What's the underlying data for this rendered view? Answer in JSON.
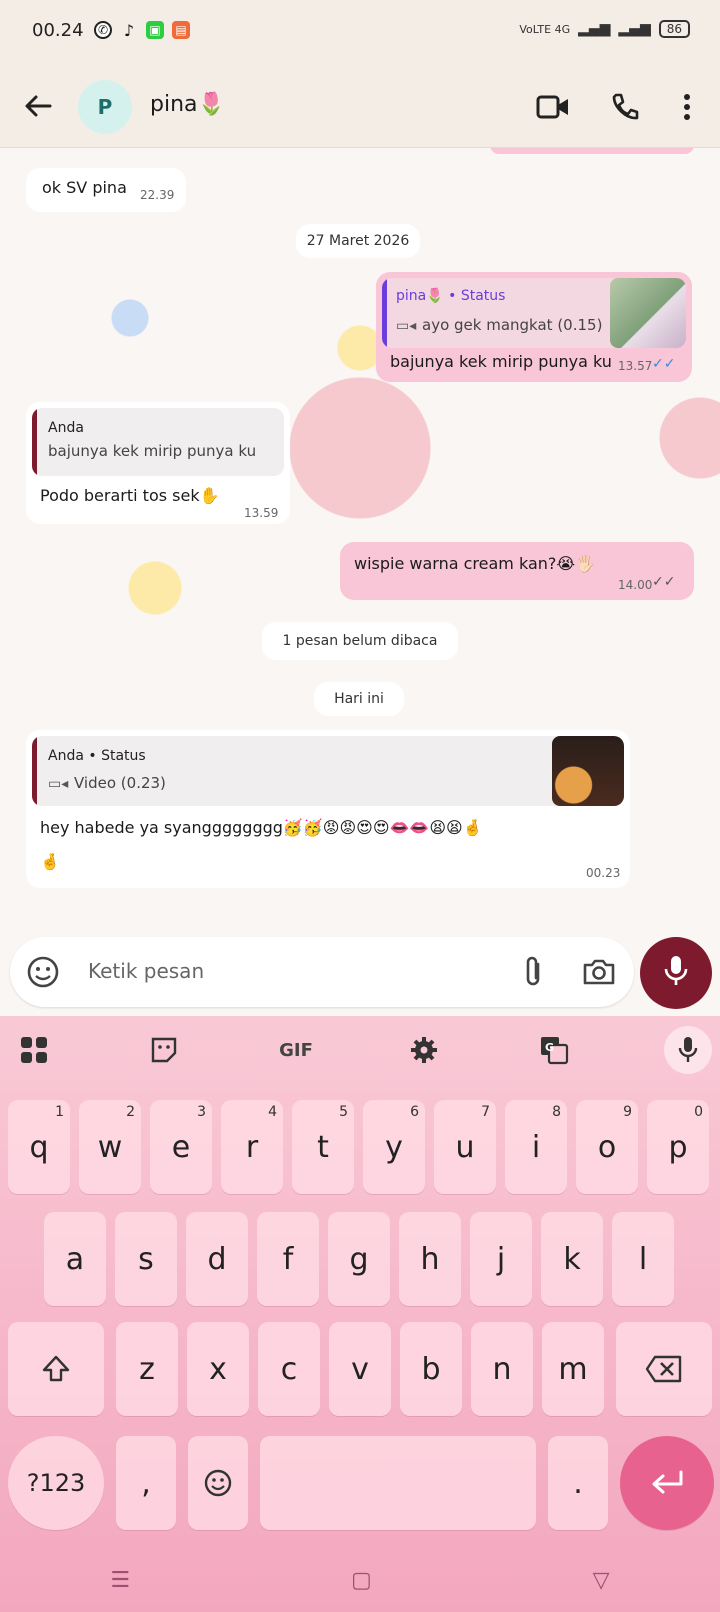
{
  "status_bar": {
    "time": "00.24",
    "network": "VoLTE 4G",
    "battery": "86"
  },
  "header": {
    "avatar_letter": "P",
    "contact_name": "pina🌷"
  },
  "messages": [
    {
      "text": "ok SV pina",
      "time": "22.39"
    },
    {
      "date_chip": "27 Maret 2026"
    },
    {
      "reply_title": "pina🌷 • Status",
      "reply_text": "ayo gek mangkat (0.15)",
      "text": "bajunya kek mirip punya ku",
      "time": "13.57"
    },
    {
      "reply_title": "Anda",
      "reply_text": "bajunya kek mirip punya ku",
      "text": "Podo berarti tos sek✋",
      "time": "13.59"
    },
    {
      "text": "wispie warna cream kan?😭🖐🏻",
      "time": "14.00"
    },
    {
      "chip": "1 pesan belum dibaca"
    },
    {
      "chip": "Hari ini"
    },
    {
      "reply_title": "Anda • Status",
      "reply_text": "Video (0.23)",
      "text": "hey habede ya syangggggggg🥳🥳😡😡😍😍👄👄😫😫🤞",
      "text2": "🤞",
      "time": "00.23"
    }
  ],
  "input": {
    "placeholder": "Ketik pesan"
  },
  "keyboard": {
    "toolbar": [
      "apps",
      "sticker",
      "GIF",
      "settings",
      "translate",
      "mic"
    ],
    "gif_label": "GIF",
    "row1": [
      "q",
      "w",
      "e",
      "r",
      "t",
      "y",
      "u",
      "i",
      "o",
      "p"
    ],
    "row1_nums": [
      "1",
      "2",
      "3",
      "4",
      "5",
      "6",
      "7",
      "8",
      "9",
      "0"
    ],
    "row2": [
      "a",
      "s",
      "d",
      "f",
      "g",
      "h",
      "j",
      "k",
      "l"
    ],
    "row3": [
      "z",
      "x",
      "c",
      "v",
      "b",
      "n",
      "m"
    ],
    "symbols_key": "?123",
    "comma_key": ",",
    "period_key": "."
  },
  "colors": {
    "out_bubble": "#f8c6d6",
    "accent": "#7d1a2e",
    "reply_bar_out": "#6a3ddc",
    "reply_bar_in": "#7d1a2e",
    "enter_key": "#e8628f"
  }
}
